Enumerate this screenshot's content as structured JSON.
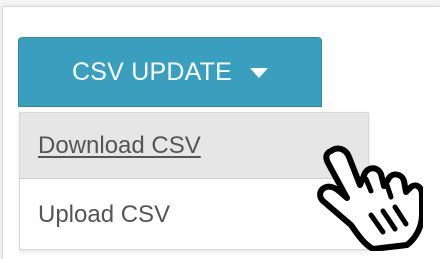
{
  "button": {
    "label": "CSV UPDATE",
    "color": "#3a9fbf"
  },
  "dropdown": {
    "items": [
      {
        "label": "Download CSV",
        "state": "hovered"
      },
      {
        "label": "Upload CSV"
      }
    ]
  },
  "cursor": {
    "icon": "pointer-hand-icon"
  }
}
